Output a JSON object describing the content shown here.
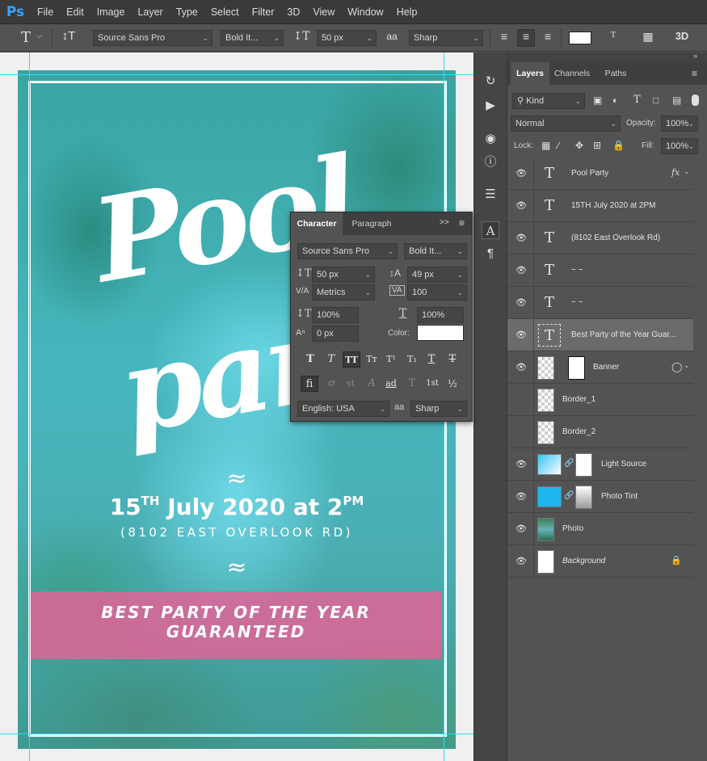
{
  "app": {
    "logo": "Ps"
  },
  "menu": [
    "File",
    "Edit",
    "Image",
    "Layer",
    "Type",
    "Select",
    "Filter",
    "3D",
    "View",
    "Window",
    "Help"
  ],
  "options_bar": {
    "tool_icon": "type-tool-icon",
    "orientation_icon": "text-orientation-icon",
    "font_family": "Source Sans Pro",
    "font_style": "Bold It...",
    "font_size": "50 px",
    "aa_label": "aa",
    "antialias": "Sharp",
    "color_swatch": "#ffffff",
    "three_d": "3D"
  },
  "poster": {
    "title": "Pool party",
    "wave1": "≈",
    "date_main": "15",
    "date_th": "TH",
    "date_mid": " July 2020 at 2",
    "date_pm": "PM",
    "address": "(8102 EAST OVERLOOK RD)",
    "wave2": "≈",
    "banner": "BEST PARTY OF THE YEAR\nGUARANTEED",
    "colors": {
      "banner": "#e86096",
      "frame": "#ffffff",
      "guides": "#29e1ef"
    }
  },
  "character_panel": {
    "tabs": [
      "Character",
      "Paragraph"
    ],
    "menu_glyph": ">>",
    "font_family": "Source Sans Pro",
    "font_style": "Bold It...",
    "font_size": "50 px",
    "leading": "49 px",
    "kerning": "Metrics",
    "tracking": "100",
    "vertical_scale": "100%",
    "horizontal_scale": "100%",
    "baseline_shift": "0 px",
    "color_label": "Color:",
    "color": "#ffffff",
    "type_styles": [
      "T",
      "T",
      "TT",
      "Tт",
      "T¹",
      "T₁",
      "T",
      "T"
    ],
    "opentype": [
      "fi",
      "ơ",
      "st",
      "A",
      "ad",
      "T",
      "1st",
      "½"
    ],
    "language": "English: USA",
    "aa_label": "aa",
    "antialias": "Sharp"
  },
  "layers_panel": {
    "tabs": [
      "Layers",
      "Channels",
      "Paths"
    ],
    "filter_kind": "Kind",
    "blend_mode": "Normal",
    "opacity_label": "Opacity:",
    "opacity": "100%",
    "lock_label": "Lock:",
    "fill_label": "Fill:",
    "fill": "100%",
    "fx": "fx",
    "layers": [
      {
        "name": "Pool  Party",
        "type": "text"
      },
      {
        "name": "15TH July 2020 at 2PM",
        "type": "text"
      },
      {
        "name": "(8102 East Overlook Rd)",
        "type": "text"
      },
      {
        "name": "~ ~",
        "type": "text"
      },
      {
        "name": "~ ~",
        "type": "text"
      },
      {
        "name": "Best Party of the Year Guar...",
        "type": "text",
        "selected": true
      },
      {
        "name": "Banner",
        "type": "image"
      },
      {
        "name": "Border_1",
        "type": "image"
      },
      {
        "name": "Border_2",
        "type": "image"
      },
      {
        "name": "Light Source",
        "type": "image"
      },
      {
        "name": "Photo Tint",
        "type": "image"
      },
      {
        "name": "Photo",
        "type": "image"
      },
      {
        "name": "Background",
        "type": "background",
        "locked": true
      }
    ]
  }
}
